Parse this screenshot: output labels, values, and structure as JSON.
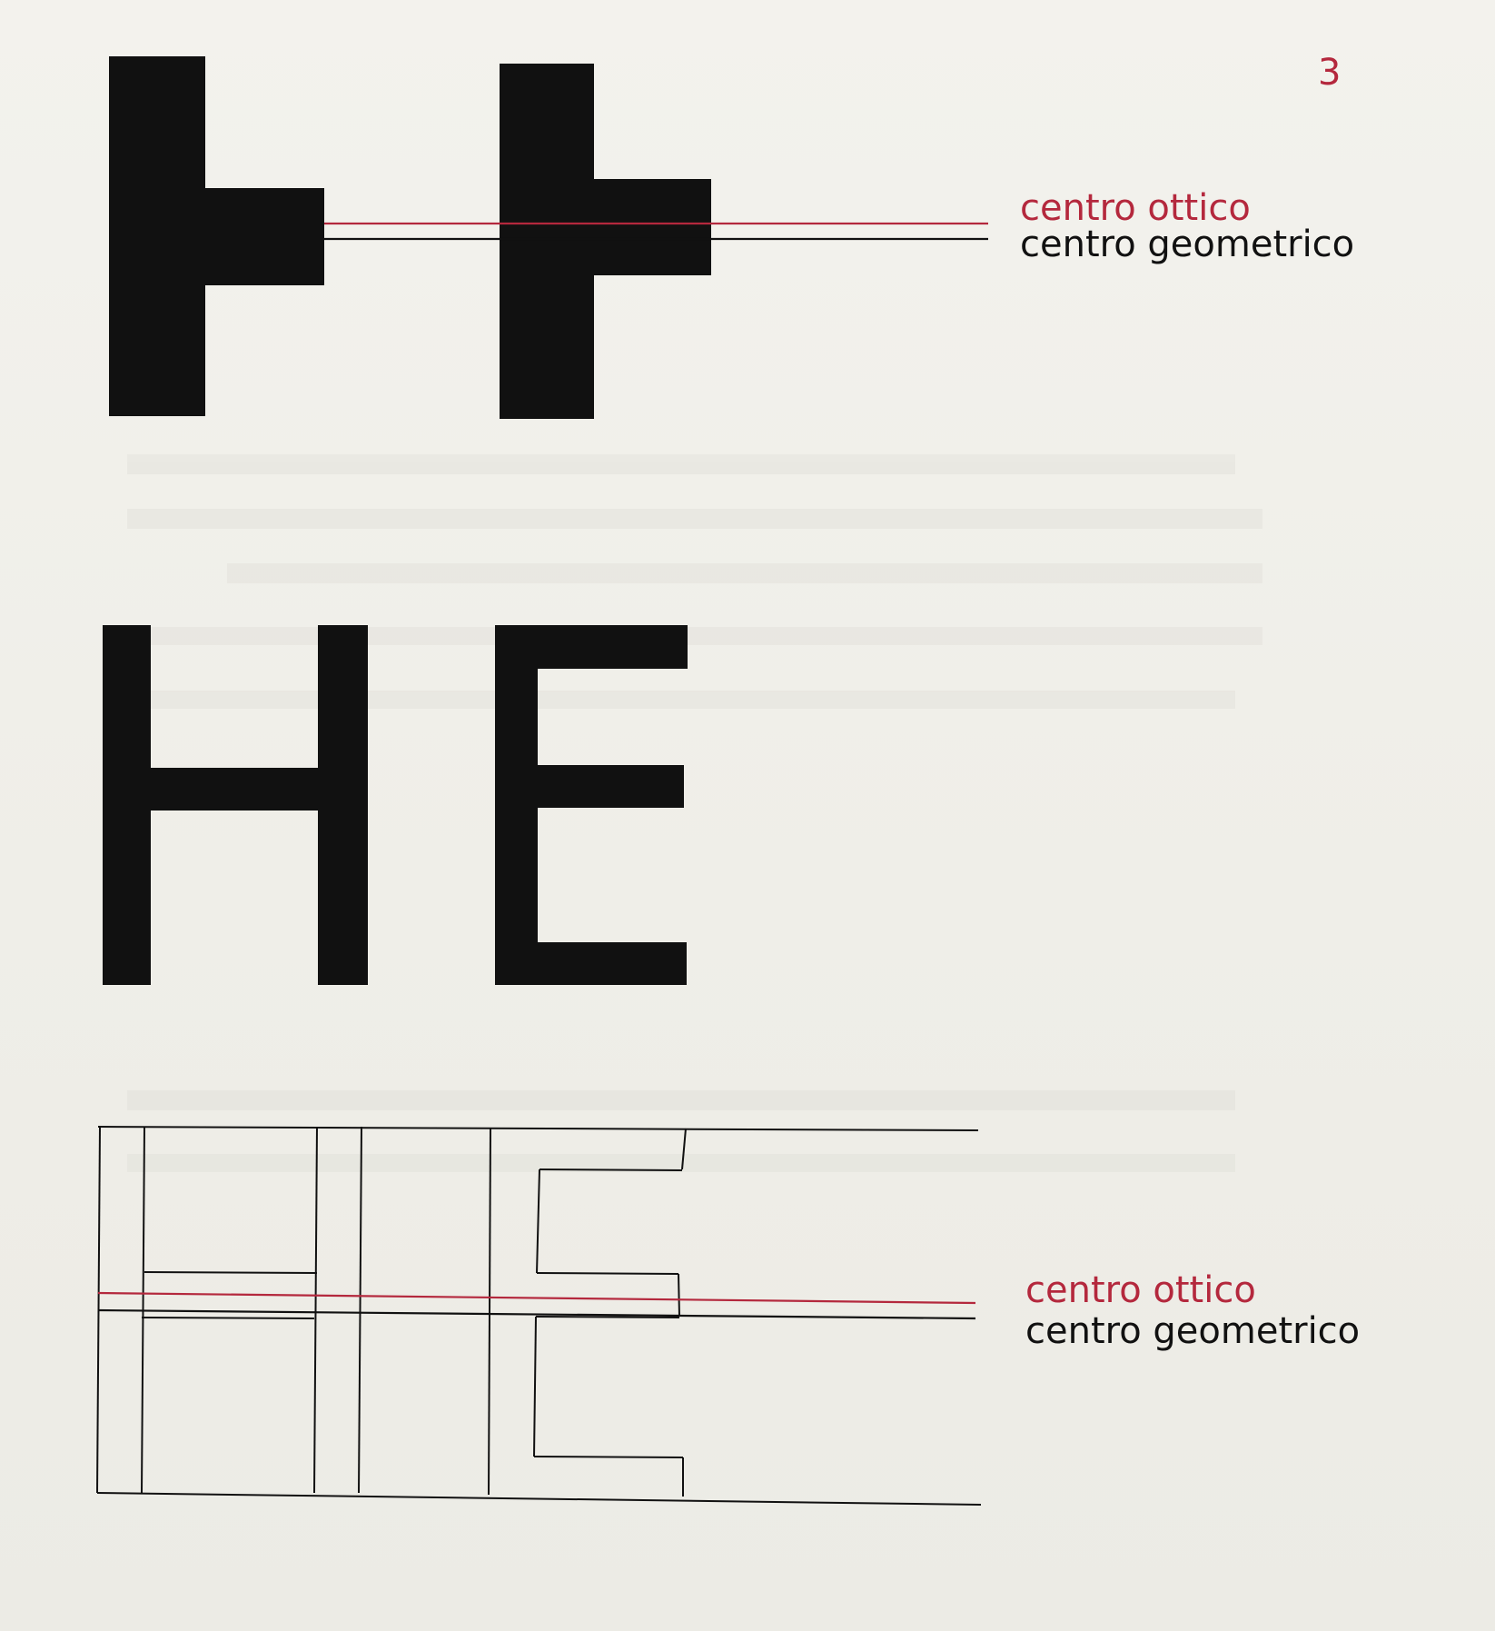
{
  "page": {
    "number": "3"
  },
  "labels": {
    "optical_center": "centro ottico",
    "geometric_center": "centro geometrico"
  },
  "letters": {
    "large": [
      "H",
      "E"
    ]
  },
  "colors": {
    "background": "#f1f0eb",
    "ink": "#111111",
    "accent_red": "#b4283d"
  }
}
